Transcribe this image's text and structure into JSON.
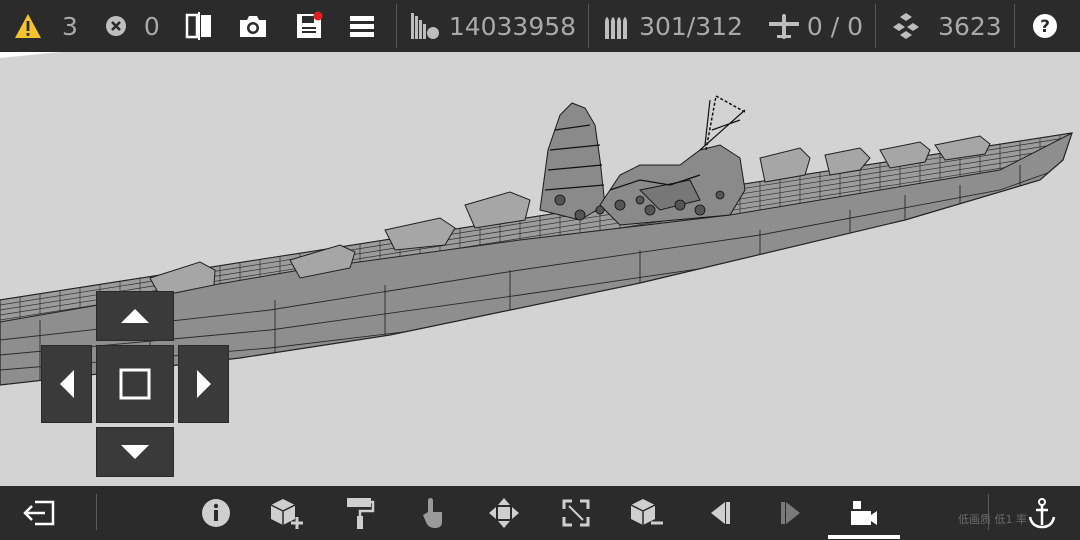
{
  "topbar": {
    "warnings_count": "3",
    "errors_count": "0",
    "weight_value": "14033958",
    "ammo_value": "301/312",
    "aircraft_value": "0 / 0",
    "parts_value": "3623",
    "icons": [
      "warning-icon",
      "error-icon",
      "mirror-icon",
      "camera-icon",
      "save-icon",
      "menu-icon",
      "weight-icon",
      "ammo-icon",
      "aircraft-icon",
      "parts-icon",
      "help-icon"
    ]
  },
  "colors": {
    "bar_bg": "#2b2b2b",
    "viewport_bg": "#d3d3d3",
    "warning": "#f4c430",
    "notification_dot": "#e02020",
    "icon": "#ffffff",
    "muted_text": "#a9a9a9"
  },
  "dpad": {
    "icons": [
      "arrow-up-icon",
      "arrow-left-icon",
      "center-square-icon",
      "arrow-right-icon",
      "arrow-down-icon"
    ]
  },
  "bottombar": {
    "icons": [
      "exit-icon",
      "info-icon",
      "add-block-icon",
      "paint-roller-icon",
      "touch-icon",
      "move-icon",
      "resize-icon",
      "remove-block-icon",
      "step-back-icon",
      "step-forward-icon",
      "camera-view-icon",
      "anchor-icon"
    ],
    "watermark": "低画质 低1 率"
  }
}
